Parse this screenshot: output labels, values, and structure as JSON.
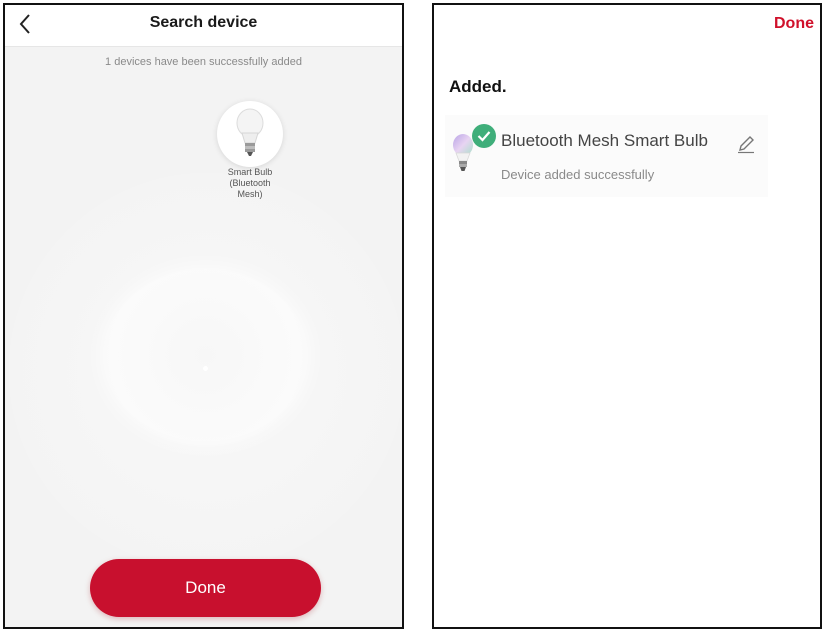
{
  "search_screen": {
    "title": "Search device",
    "subtitle": "1 devices have been successfully added",
    "found_device": {
      "label_line1": "Smart Bulb",
      "label_line2": "(Bluetooth",
      "label_line3": "Mesh)",
      "icon": "lightbulb-icon"
    },
    "done_label": "Done",
    "back_icon": "chevron-left-icon"
  },
  "added_screen": {
    "done_label": "Done",
    "heading": "Added.",
    "device": {
      "name": "Bluetooth Mesh Smart Bulb",
      "status": "Device added successfully",
      "icon": "lightbulb-icon",
      "badge_icon": "check-icon",
      "edit_icon": "pencil-icon"
    }
  },
  "colors": {
    "accent_red": "#c8102e",
    "success_green": "#3fae7a"
  }
}
